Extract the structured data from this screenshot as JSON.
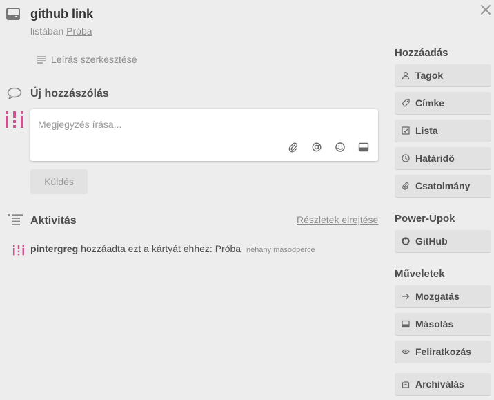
{
  "card": {
    "title": "github link",
    "list_prefix": "listában",
    "list_name": "Próba"
  },
  "description": {
    "edit_label": "Leírás szerkesztése"
  },
  "comment": {
    "section_title": "Új hozzászólás",
    "placeholder": "Megjegyzés írása...",
    "send_label": "Küldés",
    "tools": [
      "attachment-icon",
      "mention-icon",
      "emoji-icon",
      "card-icon"
    ]
  },
  "activity": {
    "section_title": "Aktivitás",
    "hide_details_label": "Részletek elrejtése",
    "items": [
      {
        "user": "pintergreg",
        "text": "hozzáadta ezt a kártyát ehhez: Próba",
        "time": "néhány másodperce"
      }
    ]
  },
  "sidebar": {
    "add_title": "Hozzáadás",
    "add_buttons": [
      {
        "label": "Tagok",
        "icon": "person-icon"
      },
      {
        "label": "Címke",
        "icon": "label-icon"
      },
      {
        "label": "Lista",
        "icon": "checklist-icon"
      },
      {
        "label": "Határidő",
        "icon": "clock-icon"
      },
      {
        "label": "Csatolmány",
        "icon": "paperclip-icon"
      }
    ],
    "powerups_title": "Power-Upok",
    "powerup_buttons": [
      {
        "label": "GitHub",
        "icon": "github-icon"
      }
    ],
    "actions_title": "Műveletek",
    "action_buttons": [
      {
        "label": "Mozgatás",
        "icon": "arrow-right-icon"
      },
      {
        "label": "Másolás",
        "icon": "card-icon"
      },
      {
        "label": "Feliratkozás",
        "icon": "eye-icon"
      },
      {
        "label": "Archiválás",
        "icon": "archive-icon"
      }
    ]
  },
  "colors": {
    "background": "#ededed",
    "avatar_accent": "#c9558f",
    "button_bg": "#e2e2e2",
    "muted_text": "#8c8c8c"
  }
}
